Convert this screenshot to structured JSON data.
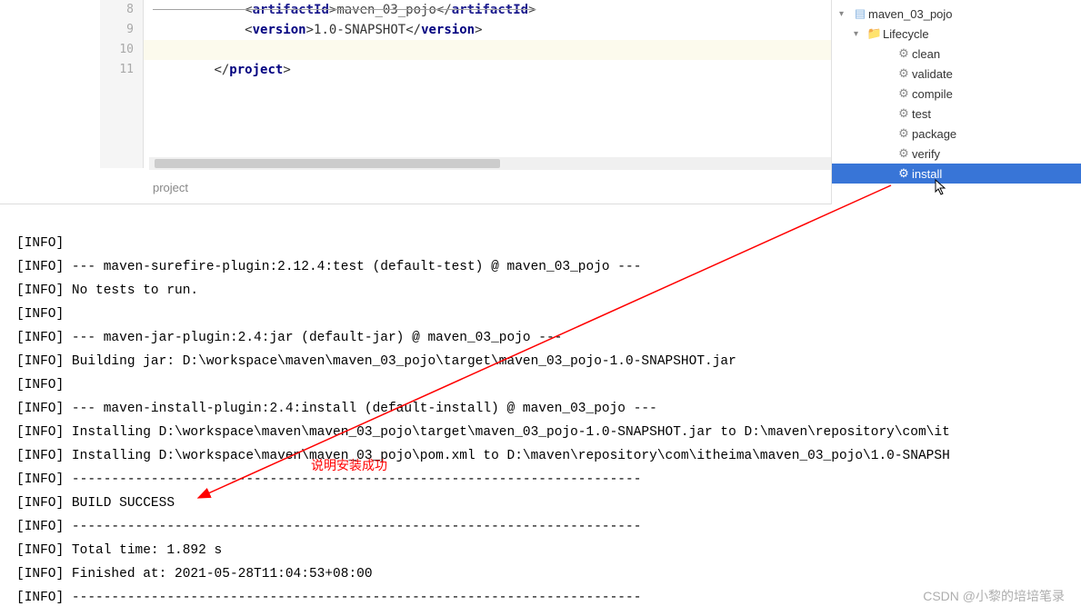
{
  "editor": {
    "lines": [
      {
        "num": "8",
        "indent": "            ",
        "tag1_open": "artifactId",
        "val": "maven_03_pojo",
        "tag1_close": "artifactId",
        "visible_partial": true
      },
      {
        "num": "9",
        "indent": "            ",
        "tag1_open": "version",
        "val": "1.0-SNAPSHOT",
        "tag1_close": "version"
      },
      {
        "num": "10",
        "indent": "",
        "blank": true,
        "highlighted": true
      },
      {
        "num": "11",
        "indent": "        ",
        "close_tag": "project"
      }
    ],
    "breadcrumb": "project"
  },
  "maven_tree": {
    "root": "maven_03_pojo",
    "folder": "Lifecycle",
    "items": [
      "clean",
      "validate",
      "compile",
      "test",
      "package",
      "verify",
      "install"
    ],
    "selected": "install"
  },
  "console": {
    "lines": [
      "[INFO]",
      "[INFO] --- maven-surefire-plugin:2.12.4:test (default-test) @ maven_03_pojo ---",
      "[INFO] No tests to run.",
      "[INFO]",
      "[INFO] --- maven-jar-plugin:2.4:jar (default-jar) @ maven_03_pojo ---",
      "[INFO] Building jar: D:\\workspace\\maven\\maven_03_pojo\\target\\maven_03_pojo-1.0-SNAPSHOT.jar",
      "[INFO]",
      "[INFO] --- maven-install-plugin:2.4:install (default-install) @ maven_03_pojo ---",
      "[INFO] Installing D:\\workspace\\maven\\maven_03_pojo\\target\\maven_03_pojo-1.0-SNAPSHOT.jar to D:\\maven\\repository\\com\\it",
      "[INFO] Installing D:\\workspace\\maven\\maven_03_pojo\\pom.xml to D:\\maven\\repository\\com\\itheima\\maven_03_pojo\\1.0-SNAPSH",
      "[INFO] ------------------------------------------------------------------------",
      "[INFO] BUILD SUCCESS",
      "[INFO] ------------------------------------------------------------------------",
      "[INFO] Total time:  1.892 s",
      "[INFO] Finished at: 2021-05-28T11:04:53+08:00",
      "[INFO] ------------------------------------------------------------------------"
    ]
  },
  "annotation": {
    "text": "说明安装成功"
  },
  "watermark": "CSDN @小黎的培培笔录"
}
